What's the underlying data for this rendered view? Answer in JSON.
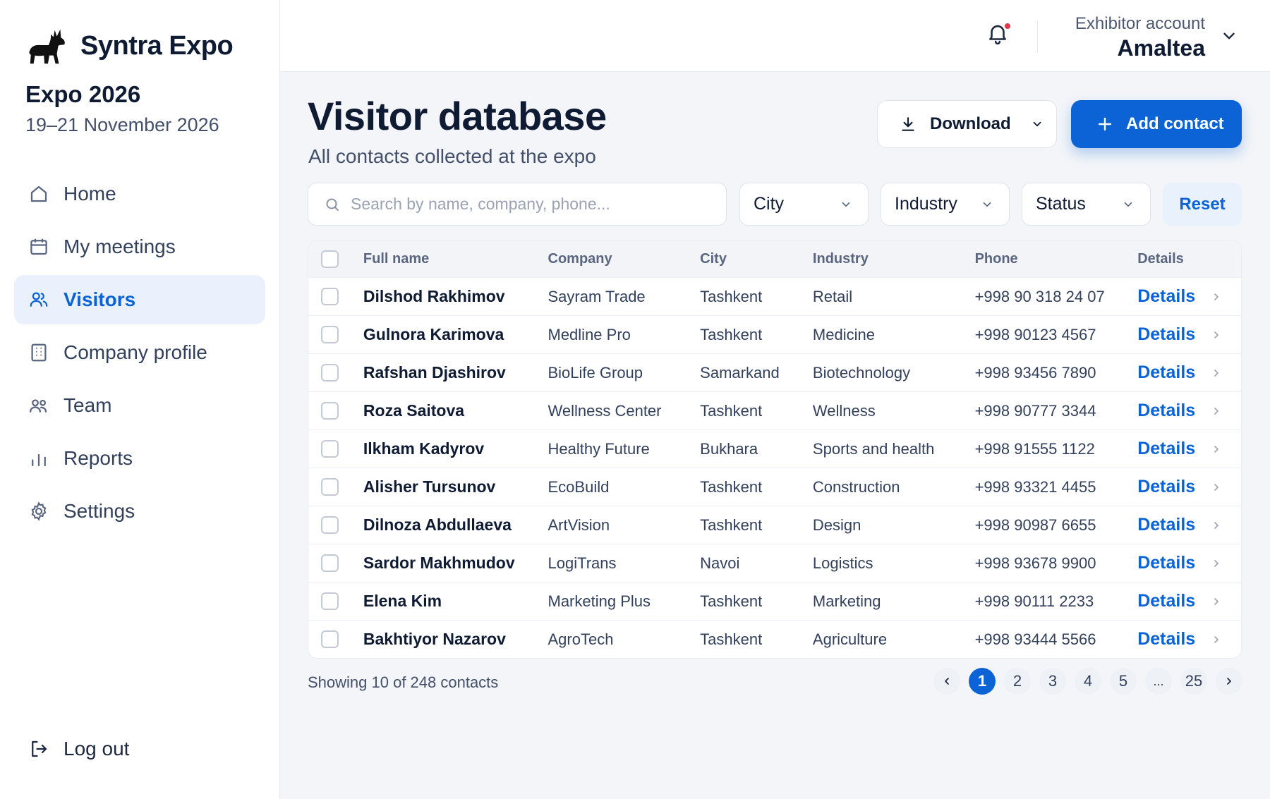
{
  "brand": {
    "name": "Syntra Expo"
  },
  "event": {
    "title": "Expo 2026",
    "dates": "19–21 November 2026"
  },
  "nav": [
    {
      "label": "Home",
      "icon": "home-icon"
    },
    {
      "label": "My meetings",
      "icon": "calendar-icon"
    },
    {
      "label": "Visitors",
      "icon": "users-icon",
      "active": true
    },
    {
      "label": "Company profile",
      "icon": "building-icon"
    },
    {
      "label": "Team",
      "icon": "team-icon"
    },
    {
      "label": "Reports",
      "icon": "bar-chart-icon"
    },
    {
      "label": "Settings",
      "icon": "gear-icon"
    }
  ],
  "logout_label": "Log out",
  "account": {
    "label": "Exhibitor account",
    "name": "Amaltea"
  },
  "page": {
    "title": "Visitor database",
    "subtitle": "All contacts collected at the expo"
  },
  "actions": {
    "download": "Download",
    "add": "Add contact"
  },
  "filters": {
    "search_placeholder": "Search by name, company, phone...",
    "city": "City",
    "industry": "Industry",
    "status": "Status",
    "reset": "Reset"
  },
  "table": {
    "columns": [
      "Full name",
      "Company",
      "City",
      "Industry",
      "Phone",
      "Details"
    ],
    "details_label": "Details",
    "rows": [
      {
        "name": "Dilshod Rakhimov",
        "company": "Sayram Trade",
        "city": "Tashkent",
        "industry": "Retail",
        "phone": "+998 90 318 24 07"
      },
      {
        "name": "Gulnora Karimova",
        "company": "Medline Pro",
        "city": "Tashkent",
        "industry": "Medicine",
        "phone": "+998 90123 4567"
      },
      {
        "name": "Rafshan Djashirov",
        "company": "BioLife Group",
        "city": "Samarkand",
        "industry": "Biotechnology",
        "phone": "+998 93456 7890"
      },
      {
        "name": "Roza Saitova",
        "company": "Wellness Center",
        "city": "Tashkent",
        "industry": "Wellness",
        "phone": "+998 90777 3344"
      },
      {
        "name": "Ilkham Kadyrov",
        "company": "Healthy Future",
        "city": "Bukhara",
        "industry": "Sports and health",
        "phone": "+998 91555 1122"
      },
      {
        "name": "Alisher Tursunov",
        "company": "EcoBuild",
        "city": "Tashkent",
        "industry": "Construction",
        "phone": "+998 93321 4455"
      },
      {
        "name": "Dilnoza Abdullaeva",
        "company": "ArtVision",
        "city": "Tashkent",
        "industry": "Design",
        "phone": "+998 90987 6655"
      },
      {
        "name": "Sardor Makhmudov",
        "company": "LogiTrans",
        "city": "Navoi",
        "industry": "Logistics",
        "phone": "+998 93678 9900"
      },
      {
        "name": "Elena Kim",
        "company": "Marketing Plus",
        "city": "Tashkent",
        "industry": "Marketing",
        "phone": "+998 90111 2233"
      },
      {
        "name": "Bakhtiyor Nazarov",
        "company": "AgroTech",
        "city": "Tashkent",
        "industry": "Agriculture",
        "phone": "+998 93444 5566"
      }
    ]
  },
  "footer": {
    "showing": "Showing 10 of 248 contacts"
  },
  "pagination": {
    "pages": [
      "1",
      "2",
      "3",
      "4",
      "5",
      "...",
      "25"
    ],
    "current": "1"
  },
  "colors": {
    "accent": "#0b63d6",
    "notification_dot": "#e8344a",
    "sidebar_active_bg": "#eaf1fc"
  }
}
